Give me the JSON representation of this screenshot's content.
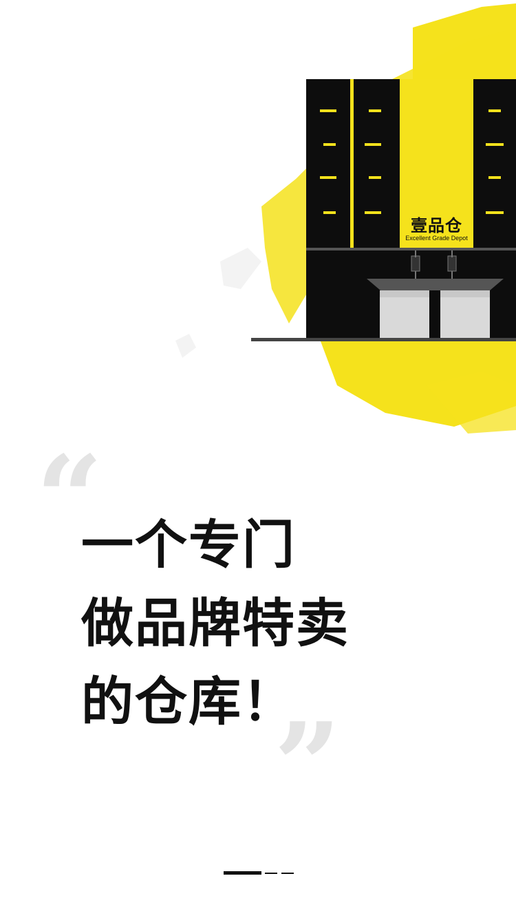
{
  "colors": {
    "accent": "#f5e21c",
    "building": "#0d0d0d",
    "window": "#f5e21c",
    "text": "#111111",
    "quote": "#e4e4e4"
  },
  "illustration": {
    "logo_title": "壹品仓",
    "logo_subtitle": "Excellent Grade Depot"
  },
  "headline": {
    "line1": "一个专门",
    "line2": "做品牌特卖",
    "line3": "的仓库！"
  },
  "quotes": {
    "open": "“",
    "close": "”"
  },
  "pagination": {
    "pages": 3,
    "active_index": 0
  }
}
